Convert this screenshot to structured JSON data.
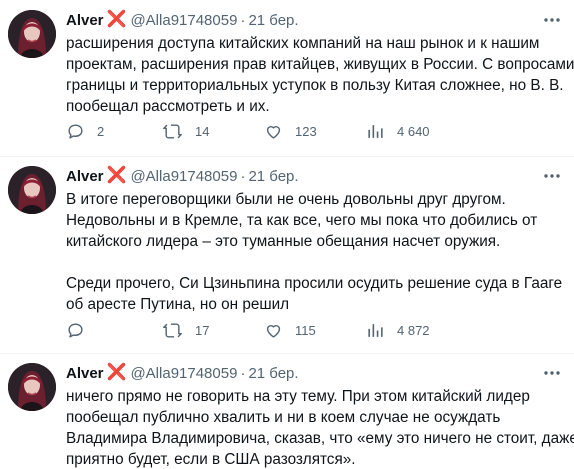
{
  "colors": {
    "text": "#0f1419",
    "muted": "#536471",
    "cross": "#e0245e",
    "divider": "#eff3f4"
  },
  "icons": [
    "reply-icon",
    "retweet-icon",
    "like-icon",
    "views-icon",
    "more-icon"
  ],
  "tweets": [
    {
      "name": "Alver",
      "badge": "❌",
      "handle": "@Alla91748059",
      "dot": "·",
      "time": "21 бер.",
      "lines": [
        "расширения доступа китайских компаний на наш рынок и к нашим",
        "проектам, расширения прав китайцев, живущих в России. С вопросами",
        "границы и территориальных уступок в пользу Китая сложнее, но В. В.",
        "пообещал рассмотреть и их."
      ],
      "replies": "2",
      "retweets": "14",
      "likes": "123",
      "views": "4 640"
    },
    {
      "name": "Alver",
      "badge": "❌",
      "handle": "@Alla91748059",
      "dot": "·",
      "time": "21 бер.",
      "lines": [
        "В итоге переговорщики были не очень довольны друг другом.",
        "Недовольны и в Кремле, та как все, чего мы пока что добились от",
        "китайского лидера – это туманные обещания насчет оружия.",
        "",
        "Среди прочего, Си Цзиньпина просили осудить решение суда в Гааге",
        "об аресте Путина, но он решил"
      ],
      "replies": "",
      "retweets": "17",
      "likes": "115",
      "views": "4 872"
    },
    {
      "name": "Alver",
      "badge": "❌",
      "handle": "@Alla91748059",
      "dot": "·",
      "time": "21 бер.",
      "lines": [
        "ничего прямо не говорить на эту тему. При этом китайский лидер",
        "пообещал публично хвалить и ни в коем случае не осуждать",
        "Владимира Владимировича, сказав, что «ему это ничего не стоит, даже",
        "приятно будет, если в США разозлятся»."
      ]
    }
  ]
}
